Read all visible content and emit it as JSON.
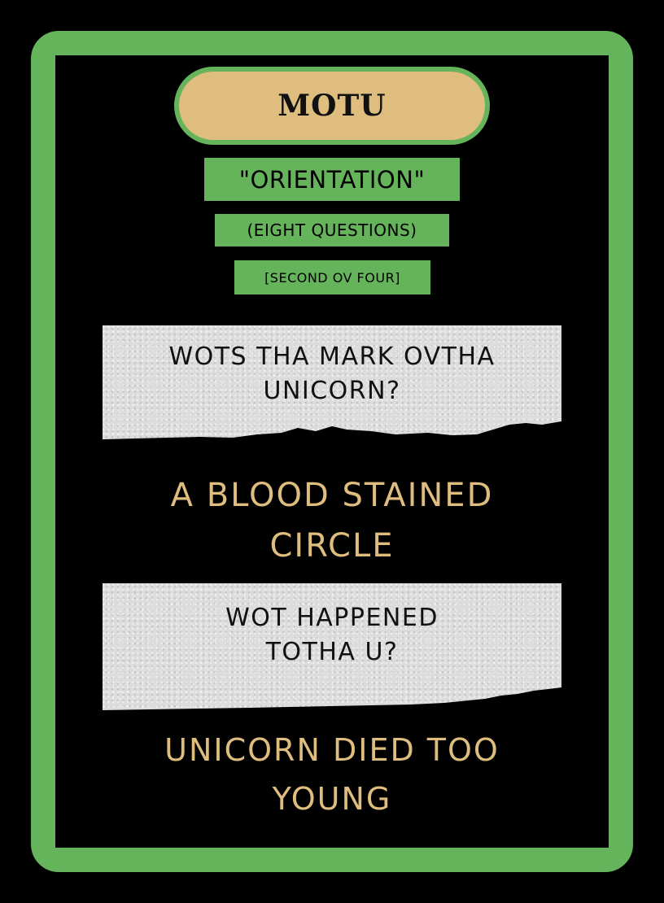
{
  "card": {
    "title": "MOTU",
    "subtitle": "\"ORIENTATION\"",
    "count_label": "(EIGHT QUESTIONS)",
    "part_label": "[SECOND OV FOUR]"
  },
  "qa": [
    {
      "question": "WOTS THA MARK OVTHA\nUNICORN?",
      "answer": "A BLOOD STAINED\nCIRCLE"
    },
    {
      "question": "WOT HAPPENED\nTOTHA U?",
      "answer": "UNICORN DIED TOO\nYOUNG"
    }
  ],
  "colors": {
    "frame_green": "#65b35b",
    "title_tan": "#dfbd7f",
    "answer_tan": "#dfbd7f",
    "background": "#000000",
    "paper_grey": "#dcdcdc"
  }
}
